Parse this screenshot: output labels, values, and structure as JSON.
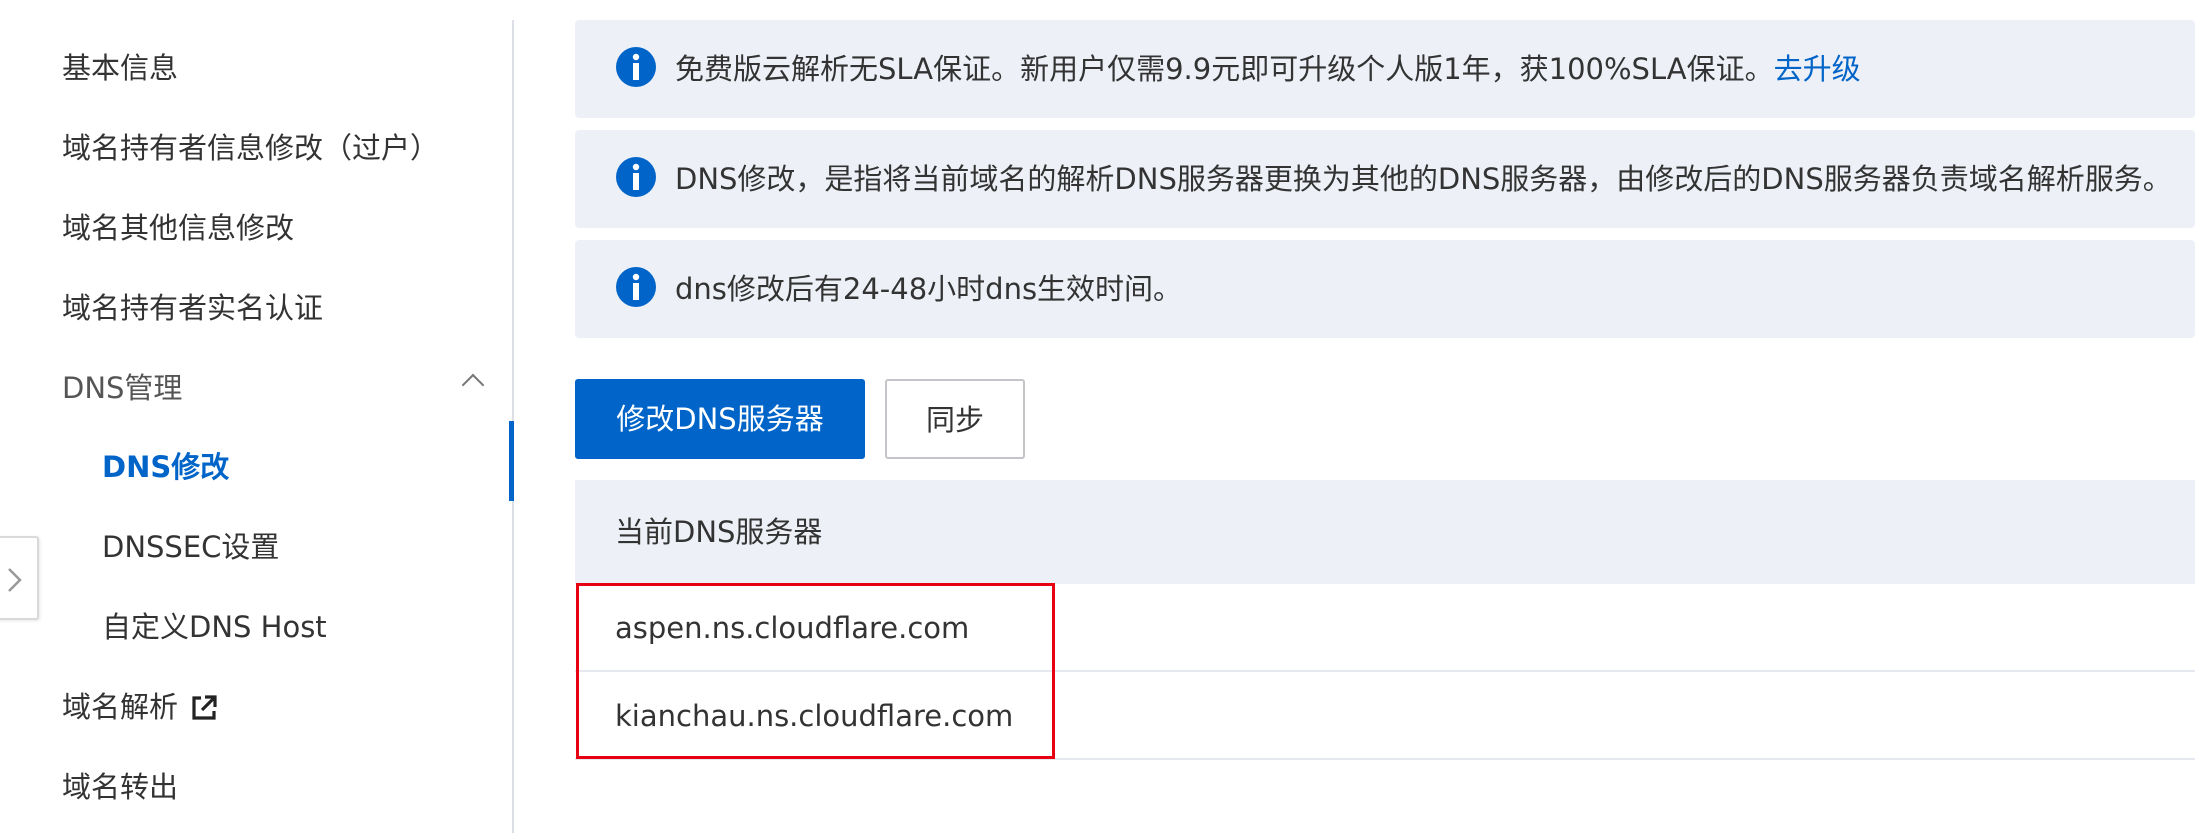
{
  "sidebar": {
    "items": [
      {
        "label": "基本信息"
      },
      {
        "label": "域名持有者信息修改（过户）"
      },
      {
        "label": "域名其他信息修改"
      },
      {
        "label": "域名持有者实名认证"
      }
    ],
    "dns_group": {
      "label": "DNS管理",
      "children": [
        {
          "label": "DNS修改"
        },
        {
          "label": "DNSSEC设置"
        },
        {
          "label": "自定义DNS Host"
        }
      ]
    },
    "domain_resolve": {
      "label": "域名解析",
      "icon": "external-link-icon"
    },
    "domain_transfer": {
      "label": "域名转出"
    }
  },
  "notices": [
    {
      "text": "免费版云解析无SLA保证。新用户仅需9.9元即可升级个人版1年，获100%SLA保证。",
      "link": "去升级"
    },
    {
      "text": "DNS修改，是指将当前域名的解析DNS服务器更换为其他的DNS服务器，由修改后的DNS服务器负责域名解析服务。"
    },
    {
      "text": "dns修改后有24-48小时dns生效时间。"
    }
  ],
  "buttons": {
    "modify_dns": "修改DNS服务器",
    "sync": "同步"
  },
  "table": {
    "header": "当前DNS服务器",
    "rows": [
      "aspen.ns.cloudflare.com",
      "kianchau.ns.cloudflare.com"
    ]
  },
  "colors": {
    "primary": "#0064c8",
    "notice_bg": "#edf1f7",
    "highlight": "#e60012"
  }
}
